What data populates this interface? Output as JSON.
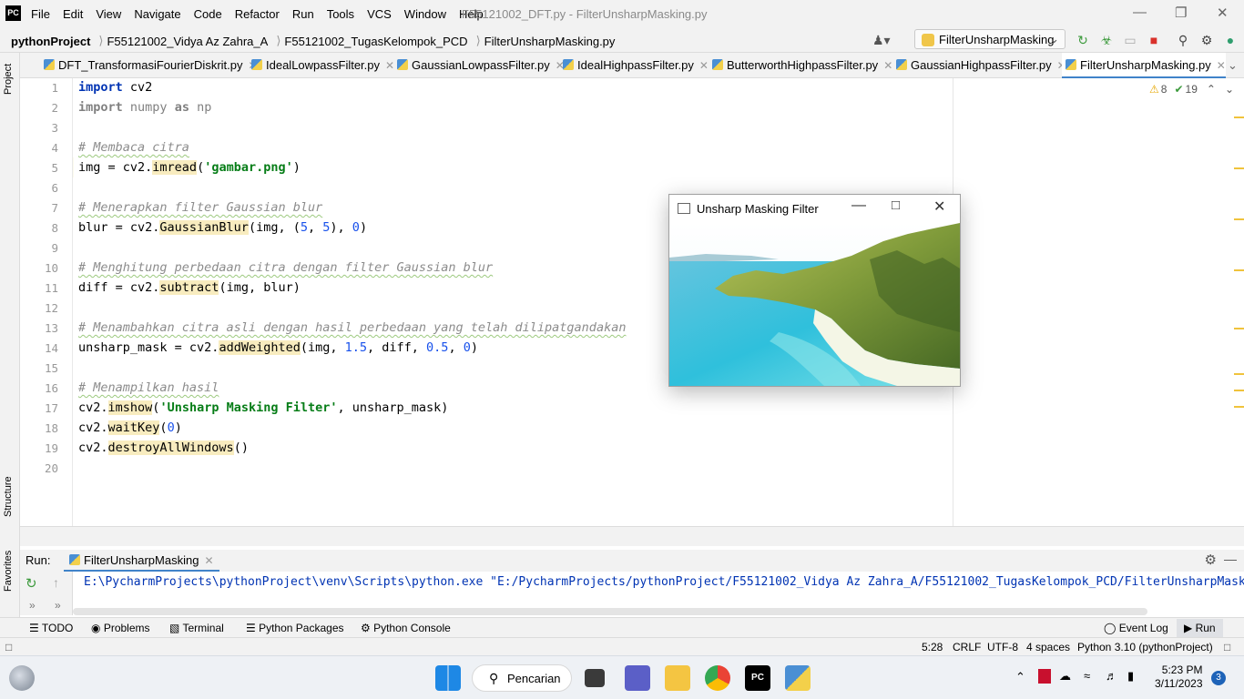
{
  "menubar": {
    "logo": "PC",
    "items": [
      "File",
      "Edit",
      "View",
      "Navigate",
      "Code",
      "Refactor",
      "Run",
      "Tools",
      "VCS",
      "Window",
      "Help"
    ],
    "window_title": "F55121002_DFT.py - FilterUnsharpMasking.py"
  },
  "breadcrumb": [
    "pythonProject",
    "F55121002_Vidya Az Zahra_A",
    "F55121002_TugasKelompok_PCD",
    "FilterUnsharpMasking.py"
  ],
  "run_config": "FilterUnsharpMasking",
  "tabs": [
    "DFT_TransformasiFourierDiskrit.py",
    "IdealLowpassFilter.py",
    "GaussianLowpassFilter.py",
    "IdealHighpassFilter.py",
    "ButterworthHighpassFilter.py",
    "GaussianHighpassFilter.py",
    "FilterUnsharpMasking.py"
  ],
  "active_tab": "FilterUnsharpMasking.py",
  "side_labels": {
    "project": "Project",
    "structure": "Structure",
    "favorites": "Favorites"
  },
  "inspections": {
    "warnings": "8",
    "ok": "19"
  },
  "line_numbers": [
    "1",
    "2",
    "3",
    "4",
    "5",
    "6",
    "7",
    "8",
    "9",
    "10",
    "11",
    "12",
    "13",
    "14",
    "15",
    "16",
    "17",
    "18",
    "19",
    "20"
  ],
  "code": {
    "l1_kw": "import",
    "l1_rest": " cv2",
    "l2_kw": "import",
    "l2_mod": " numpy ",
    "l2_as": "as",
    "l2_np": " np",
    "l4": "# Membaca citra",
    "l5_a": "img = cv2.",
    "l5_fn": "imread",
    "l5_b": "(",
    "l5_str": "'gambar.png'",
    "l5_c": ")",
    "l7": "# Menerapkan filter Gaussian blur",
    "l8_a": "blur = cv2.",
    "l8_fn": "GaussianBlur",
    "l8_b": "(img, (",
    "l8_n1": "5",
    "l8_c": ", ",
    "l8_n2": "5",
    "l8_d": "), ",
    "l8_n3": "0",
    "l8_e": ")",
    "l10": "# Menghitung perbedaan citra dengan filter Gaussian blur",
    "l11_a": "diff = cv2.",
    "l11_fn": "subtract",
    "l11_b": "(img, blur)",
    "l13": "# Menambahkan citra asli dengan hasil perbedaan yang telah dilipatgandakan",
    "l14_a": "unsharp_mask = cv2.",
    "l14_fn": "addWeighted",
    "l14_b": "(img, ",
    "l14_n1": "1.5",
    "l14_c": ", diff, ",
    "l14_n2": "0.5",
    "l14_d": ", ",
    "l14_n3": "0",
    "l14_e": ")",
    "l16": "# Menampilkan hasil",
    "l17_a": "cv2.",
    "l17_fn": "imshow",
    "l17_b": "(",
    "l17_str": "'Unsharp Masking Filter'",
    "l17_c": ", unsharp_mask)",
    "l18_a": "cv2.",
    "l18_fn": "waitKey",
    "l18_b": "(",
    "l18_n": "0",
    "l18_c": ")",
    "l19_a": "cv2.",
    "l19_fn": "destroyAllWindows",
    "l19_b": "()"
  },
  "popup": {
    "title": "Unsharp Masking Filter"
  },
  "run_panel": {
    "label": "Run:",
    "tab": "FilterUnsharpMasking",
    "command": "E:\\PycharmProjects\\pythonProject\\venv\\Scripts\\python.exe \"E:/PycharmProjects/pythonProject/F55121002_Vidya Az Zahra_A/F55121002_TugasKelompok_PCD/FilterUnsharpMasking.py\""
  },
  "bottom_tools": [
    "TODO",
    "Problems",
    "Terminal",
    "Python Packages",
    "Python Console"
  ],
  "bottom_right": [
    "Event Log",
    "Run"
  ],
  "status": {
    "position": "5:28",
    "line_sep": "CRLF",
    "encoding": "UTF-8",
    "indent": "4 spaces",
    "interpreter": "Python 3.10 (pythonProject)"
  },
  "taskbar": {
    "search": "Pencarian",
    "time": "5:23 PM",
    "date": "3/11/2023",
    "notif": "3"
  },
  "colors": {
    "accent": "#4083c9",
    "keyword": "#0033b3",
    "string": "#067d17",
    "number": "#1750eb",
    "comment": "#8c8c8c"
  }
}
